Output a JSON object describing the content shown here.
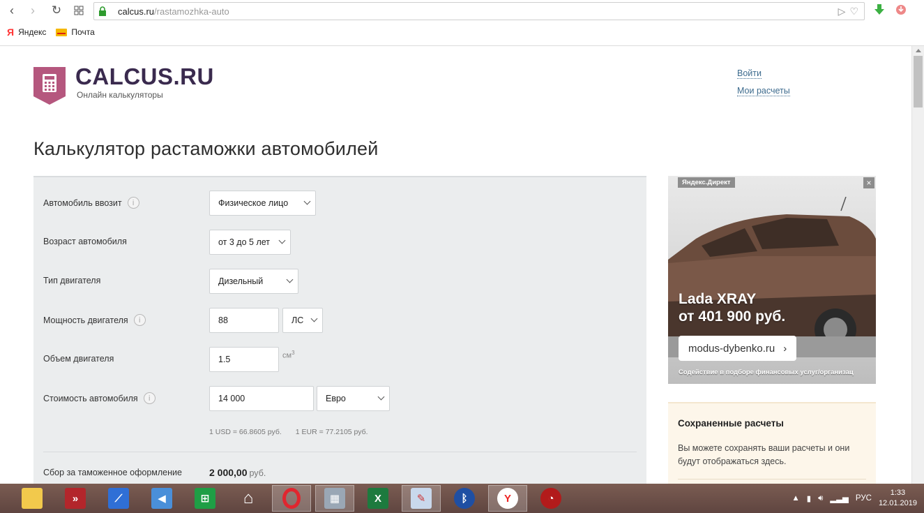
{
  "browser": {
    "url_host": "calcus.ru",
    "url_path": "/rastamozhka-auto",
    "bookmarks": [
      {
        "label": "Яндекс",
        "icon": "yandex-icon"
      },
      {
        "label": "Почта",
        "icon": "mail-icon"
      }
    ]
  },
  "header": {
    "brand": "CALCUS.RU",
    "subtitle": "Онлайн калькуляторы",
    "login": "Войти",
    "my_calcs": "Мои расчеты"
  },
  "page_title": "Калькулятор растаможки автомобилей",
  "form": {
    "importer": {
      "label": "Автомобиль ввозит",
      "value": "Физическое лицо"
    },
    "age": {
      "label": "Возраст автомобиля",
      "value": "от 3 до 5 лет"
    },
    "engine_type": {
      "label": "Тип двигателя",
      "value": "Дизельный"
    },
    "power": {
      "label": "Мощность двигателя",
      "value": "88",
      "unit": "ЛС"
    },
    "volume": {
      "label": "Объем двигателя",
      "value": "1.5",
      "unit": "см",
      "unit_sup": "3"
    },
    "price": {
      "label": "Стоимость автомобиля",
      "value": "14 000",
      "currency": "Евро"
    },
    "rates": {
      "usd": "1 USD = 66.8605 руб.",
      "eur": "1 EUR = 77.2105 руб."
    },
    "fee": {
      "label": "Сбор за таможенное оформление",
      "value": "2 000,00",
      "currency": "руб."
    }
  },
  "ad": {
    "tag": "Яндекс.Директ",
    "close": "×",
    "title_line1": "Lada XRAY",
    "title_line2": "от 401 900 руб.",
    "button": "modus-dybenko.ru",
    "button_arrow": "›",
    "footer": "Содействие в подборе финансовых услуг/организац"
  },
  "saved": {
    "title": "Сохраненные расчеты",
    "text": "Вы можете сохранять ваши расчеты и они будут отображаться здесь."
  },
  "taskbar": {
    "lang": "РУС",
    "time": "1:33",
    "date": "12.01.2019"
  },
  "colors": {
    "brand": "#3a2a4e",
    "logo_badge": "#b5577e",
    "link": "#3d6b8e",
    "form_bg": "#ebedee",
    "saved_bg": "#fdf6ea",
    "taskbar": "#6b4f48"
  }
}
